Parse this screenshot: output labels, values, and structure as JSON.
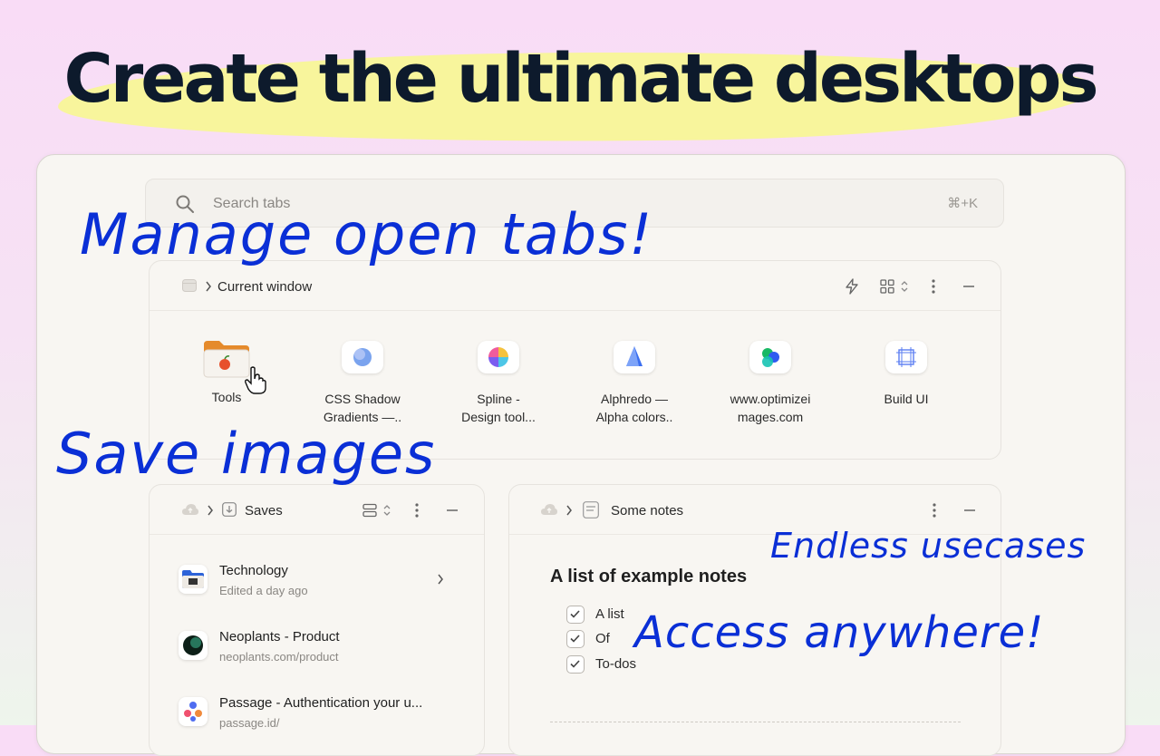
{
  "hero": {
    "title": "Create the ultimate desktops"
  },
  "search": {
    "placeholder": "Search tabs",
    "shortcut": "⌘+K"
  },
  "current_window": {
    "breadcrumb": "Current window",
    "tabs": [
      {
        "label_line1": "Tools",
        "label_line2": ""
      },
      {
        "label_line1": "CSS Shadow",
        "label_line2": "Gradients —.."
      },
      {
        "label_line1": "Spline -",
        "label_line2": "Design tool..."
      },
      {
        "label_line1": "Alphredo —",
        "label_line2": "Alpha colors.."
      },
      {
        "label_line1": "www.optimizei",
        "label_line2": "mages.com"
      },
      {
        "label_line1": "Build UI",
        "label_line2": ""
      }
    ]
  },
  "saves": {
    "title": "Saves",
    "items": [
      {
        "title": "Technology",
        "subtitle": "Edited a day ago"
      },
      {
        "title": "Neoplants - Product",
        "subtitle": "neoplants.com/product"
      },
      {
        "title": "Passage - Authentication your u...",
        "subtitle": "passage.id/"
      }
    ]
  },
  "notes": {
    "title": "Some notes",
    "heading": "A list of example notes",
    "todos": [
      "A list",
      "Of",
      "To-dos"
    ]
  },
  "annotations": {
    "manage": "Manage open tabs!",
    "save": "Save images",
    "endless": "Endless usecases",
    "access": "Access anywhere!"
  },
  "colors": {
    "accent_ink": "#0a2fd6",
    "highlight": "#f8f59c",
    "title_ink": "#0d1a2c"
  }
}
